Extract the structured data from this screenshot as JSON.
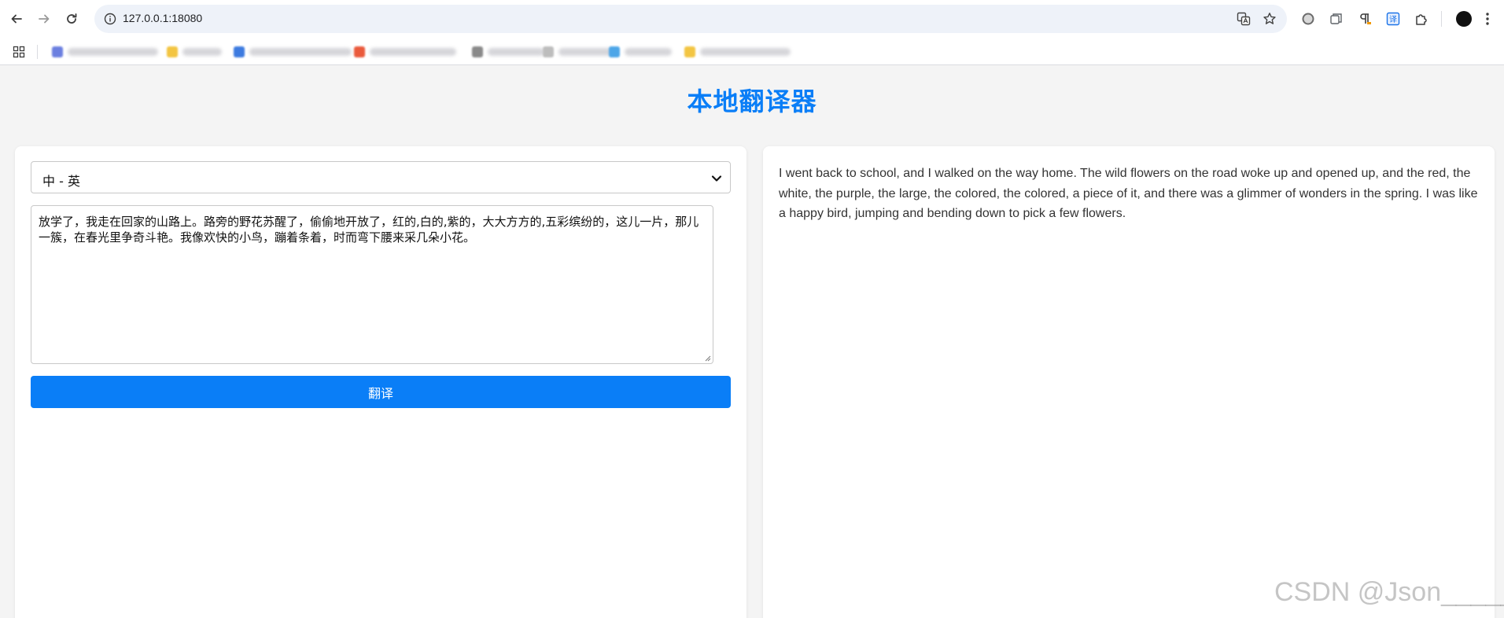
{
  "browser": {
    "url": "127.0.0.1:18080",
    "bookmarks": [
      {
        "color": "#6b7fe0",
        "text_width": 115
      },
      {
        "color": "#f3c542",
        "text_width": 50
      },
      {
        "color": "#3d7be0",
        "text_width": 130
      },
      {
        "color": "#ea5a3c",
        "text_width": 110
      },
      {
        "color": "#8a8a8a",
        "text_width": 72
      },
      {
        "color": "#bdbdbd",
        "text_width": 70
      },
      {
        "color": "#4da6e8",
        "text_width": 60
      },
      {
        "color": "#f3c542",
        "text_width": 115
      }
    ]
  },
  "page": {
    "title": "本地翻译器"
  },
  "translator": {
    "language_option": "中 - 英",
    "source_text": "放学了，我走在回家的山路上。路旁的野花苏醒了，偷偷地开放了，红的,白的,紫的，大大方方的,五彩缤纷的，这儿一片，那儿一簇，在春光里争奇斗艳。我像欢快的小鸟，蹦着条着，时而弯下腰来采几朵小花。",
    "button_label": "翻译",
    "result_text": "I went back to school, and I walked on the way home. The wild flowers on the road woke up and opened up, and the red, the white, the purple, the large, the colored, the colored, a piece of it, and there was a glimmer of wonders in the spring. I was like a happy bird, jumping and bending down to pick a few flowers."
  },
  "watermark": "CSDN @Json_____",
  "colors": {
    "accent": "#0a7ef7",
    "background": "#f4f4f4"
  }
}
